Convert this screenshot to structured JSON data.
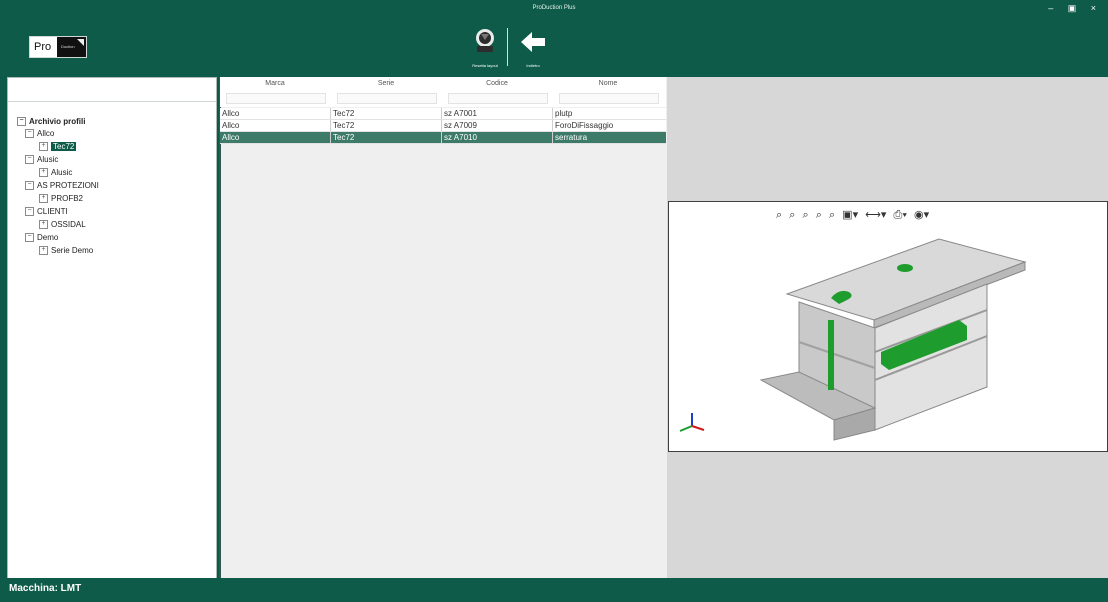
{
  "window": {
    "title": "ProDuction Plus",
    "controls": "– ▣ ×"
  },
  "logo": {
    "text": "Pro",
    "mini": "Duction"
  },
  "toolbar": {
    "reset_label": "Resetta layout",
    "back_label": "Indietro"
  },
  "tree": {
    "root": "Archivio profili",
    "nodes": [
      {
        "label": "Allco",
        "children": [
          "Tec72"
        ]
      },
      {
        "label": "Alusic",
        "children": [
          "Alusic"
        ]
      },
      {
        "label": "AS PROTEZIONI",
        "children": [
          "PROFB2"
        ]
      },
      {
        "label": "CLIENTI",
        "children": [
          "OSSIDAL"
        ]
      },
      {
        "label": "Demo",
        "children": [
          "Serie Demo"
        ]
      }
    ]
  },
  "table": {
    "columns": [
      "Marca",
      "Serie",
      "Codice",
      "Nome"
    ],
    "rows": [
      [
        "Allco",
        "Tec72",
        "sz A7001",
        "plutp"
      ],
      [
        "Allco",
        "Tec72",
        "sz A7009",
        "ForoDiFissaggio"
      ],
      [
        "Allco",
        "Tec72",
        "sz A7010",
        "serratura"
      ]
    ],
    "selected_row": 2
  },
  "viewer": {
    "tools": [
      "⌕",
      "⌕",
      "⌕",
      "⌕",
      "⌕",
      "▣▾",
      "⟷▾",
      "⎙▾",
      "◉▾"
    ]
  },
  "status": {
    "label": "Macchina: LMT"
  },
  "colors": {
    "brand": "#0d5b48",
    "selection": "#3d7b68",
    "hole": "#1f9c2e"
  }
}
